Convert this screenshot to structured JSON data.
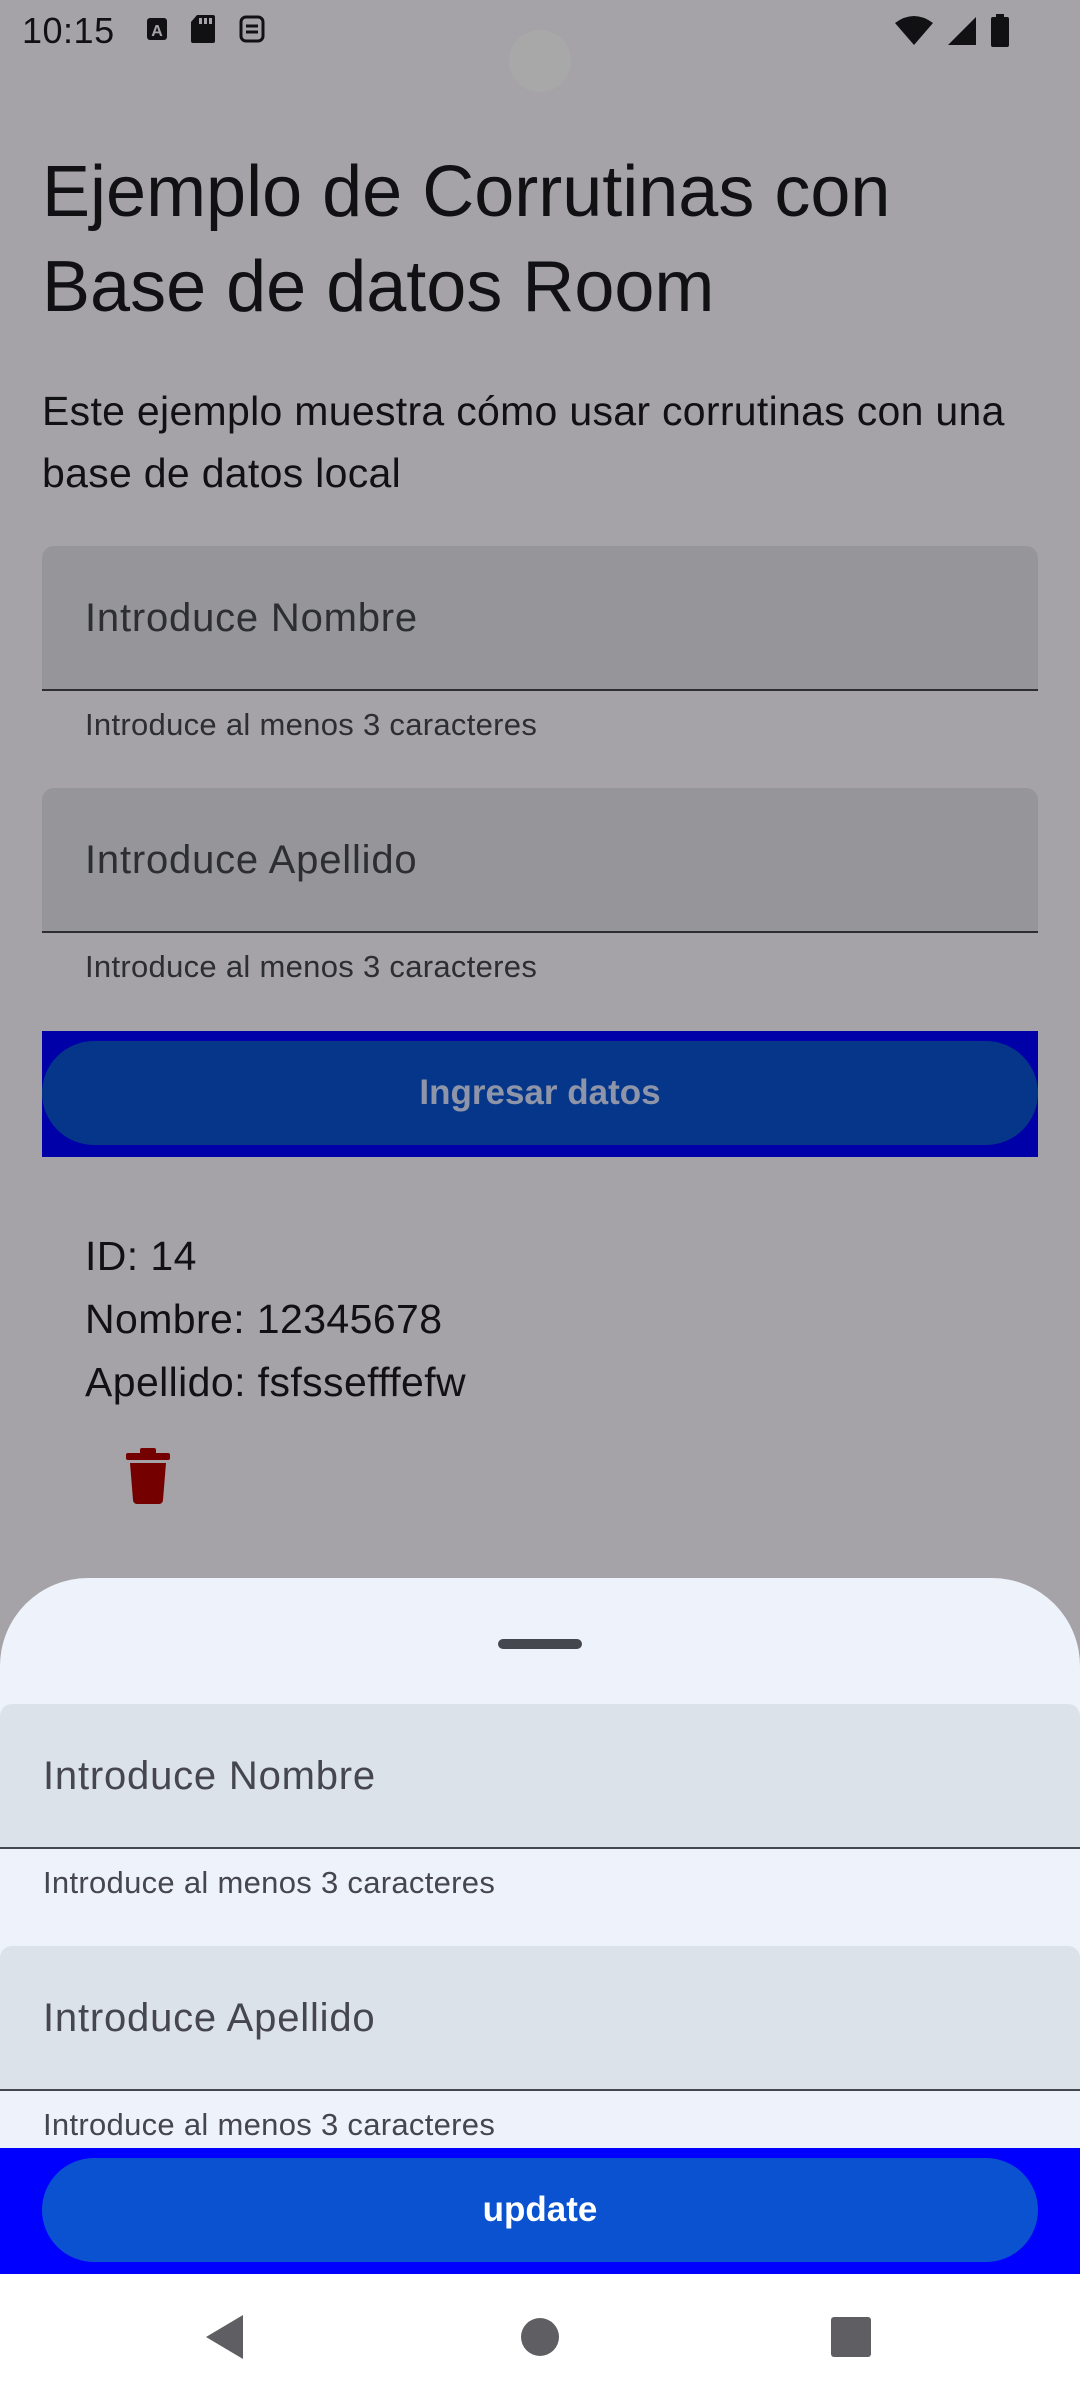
{
  "status_bar": {
    "time": "10:15",
    "left_icons": [
      "a-notification-icon",
      "sd-card-icon",
      "sync-icon"
    ],
    "right_icons": [
      "wifi-icon",
      "signal-icon",
      "battery-icon"
    ]
  },
  "page": {
    "title": "Ejemplo de Corrutinas con Base de datos Room",
    "subtitle": "Este ejemplo muestra cómo usar corrutinas con una base de datos local"
  },
  "form": {
    "name_placeholder": "Introduce Nombre",
    "name_helper": "Introduce al menos 3 caracteres",
    "surname_placeholder": "Introduce Apellido",
    "surname_helper": "Introduce al menos 3 caracteres",
    "submit_label": "Ingresar datos"
  },
  "record": {
    "id_line": "ID: 14",
    "name_line": "Nombre: 12345678",
    "surname_line": "Apellido: fsfssefffefw"
  },
  "sheet": {
    "name_placeholder": "Introduce Nombre",
    "name_helper": "Introduce al menos 3 caracteres",
    "surname_placeholder": "Introduce Apellido",
    "surname_helper": "Introduce al menos 3 caracteres",
    "update_label": "update"
  },
  "nav_bar": {
    "buttons": [
      "back-icon",
      "home-icon",
      "recents-icon"
    ]
  },
  "colors": {
    "button_highlight": "#0000ff",
    "button_fill": "#0a52d0",
    "delete_icon": "#b00000",
    "sheet_background": "#edf2fb"
  }
}
